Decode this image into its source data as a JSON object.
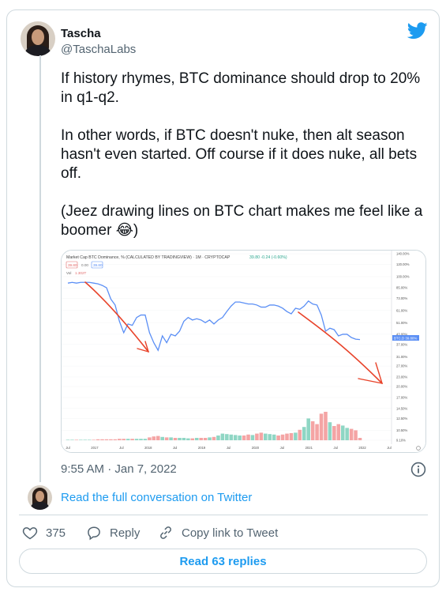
{
  "author": {
    "name": "Tascha",
    "handle": "@TaschaLabs"
  },
  "tweet": {
    "paragraphs": [
      "If history rhymes, BTC dominance should drop to 20% in q1-q2.",
      "In other words, if BTC doesn't nuke, then alt season hasn't even started. Off course if it does nuke, all bets off.",
      "(Jeez drawing lines on BTC chart makes me feel like a boomer 😂)"
    ]
  },
  "chart": {
    "title": "Market Cap BTC Dominance, % (CALCULATED BY TRADINGVIEW) · 1M · CRYPTOCAP",
    "values_readout": "39.80  -0.24 (-0.60%)",
    "badge_1": "39.80",
    "badge_2": "0.00",
    "badge_3": "39.80",
    "vol_label": "Vol",
    "vol_value": "1.302T",
    "price_tag": "BTC.D  39.80%",
    "y_ticks": [
      "140.00%",
      "120.00%",
      "100.00%",
      "85.00%",
      "73.00%",
      "61.00%",
      "51.00%",
      "43.00%",
      "37.00%",
      "31.00%",
      "27.00%",
      "23.00%",
      "20.00%",
      "17.00%",
      "14.50%",
      "12.50%",
      "10.50%",
      "9.10%"
    ],
    "x_ticks": [
      "Jul",
      "2017",
      "Jul",
      "2018",
      "Jul",
      "2019",
      "Jul",
      "2020",
      "Jul",
      "2021",
      "Jul",
      "2022",
      "Jul"
    ],
    "colors": {
      "line": "#5b8ff5",
      "up_bar": "#8fd6c4",
      "down_bar": "#f4a4a4",
      "annotation": "#e8432a"
    }
  },
  "chart_data": {
    "type": "line",
    "title": "Market Cap BTC Dominance, % (CALCULATED BY TRADINGVIEW)",
    "y_scale": "log",
    "x": [
      "2016-05",
      "2016-06",
      "2016-07",
      "2016-08",
      "2016-09",
      "2016-10",
      "2016-11",
      "2016-12",
      "2017-01",
      "2017-02",
      "2017-03",
      "2017-04",
      "2017-05",
      "2017-06",
      "2017-07",
      "2017-08",
      "2017-09",
      "2017-10",
      "2017-11",
      "2017-12",
      "2018-01",
      "2018-02",
      "2018-03",
      "2018-04",
      "2018-05",
      "2018-06",
      "2018-07",
      "2018-08",
      "2018-09",
      "2018-10",
      "2018-11",
      "2018-12",
      "2019-01",
      "2019-02",
      "2019-03",
      "2019-04",
      "2019-05",
      "2019-06",
      "2019-07",
      "2019-08",
      "2019-09",
      "2019-10",
      "2019-11",
      "2019-12",
      "2020-01",
      "2020-02",
      "2020-03",
      "2020-04",
      "2020-05",
      "2020-06",
      "2020-07",
      "2020-08",
      "2020-09",
      "2020-10",
      "2020-11",
      "2020-12",
      "2021-01",
      "2021-02",
      "2021-03",
      "2021-04",
      "2021-05",
      "2021-06",
      "2021-07",
      "2021-08",
      "2021-09",
      "2021-10",
      "2021-11",
      "2021-12",
      "2022-01"
    ],
    "series": [
      {
        "values": [
          91,
          92,
          91,
          92,
          92,
          92,
          91,
          90,
          88,
          85,
          72,
          66,
          52,
          44,
          50,
          49,
          55,
          57,
          57,
          44,
          38,
          34,
          42,
          38,
          43,
          42,
          45,
          52,
          55,
          53,
          54,
          53,
          51,
          53,
          50,
          53,
          55,
          60,
          65,
          69,
          69,
          68,
          67,
          67,
          66,
          64,
          64,
          66,
          66,
          65,
          63,
          60,
          58,
          63,
          62,
          65,
          70,
          67,
          66,
          57,
          45,
          47,
          46,
          42,
          43,
          43,
          41,
          40,
          39.8
        ]
      }
    ],
    "volume_relative": [
      0.01,
      0.01,
      0.01,
      0.01,
      0.01,
      0.01,
      0.01,
      0.02,
      0.02,
      0.02,
      0.02,
      0.02,
      0.03,
      0.03,
      0.03,
      0.03,
      0.03,
      0.03,
      0.03,
      0.06,
      0.08,
      0.09,
      0.07,
      0.06,
      0.06,
      0.05,
      0.05,
      0.05,
      0.04,
      0.04,
      0.05,
      0.05,
      0.05,
      0.06,
      0.07,
      0.1,
      0.14,
      0.13,
      0.12,
      0.11,
      0.1,
      0.1,
      0.12,
      0.11,
      0.14,
      0.16,
      0.14,
      0.13,
      0.12,
      0.1,
      0.12,
      0.14,
      0.15,
      0.16,
      0.22,
      0.28,
      0.46,
      0.4,
      0.34,
      0.56,
      0.6,
      0.38,
      0.3,
      0.34,
      0.31,
      0.26,
      0.24,
      0.21,
      0.05
    ]
  },
  "timestamp": "9:55 AM · Jan 7, 2022",
  "read_full": "Read the full conversation on Twitter",
  "actions": {
    "likes": "375",
    "reply": "Reply",
    "copy": "Copy link to Tweet"
  },
  "read_replies": "Read 63 replies"
}
